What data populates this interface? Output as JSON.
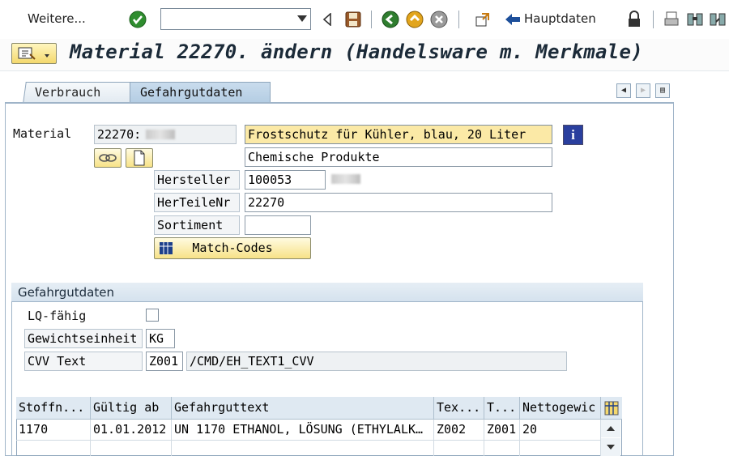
{
  "toolbar": {
    "more_label": "Weitere...",
    "command_value": "",
    "hauptdaten_label": "Hauptdaten",
    "icons": [
      "check-icon",
      "save-icon",
      "back-icon",
      "exit-icon",
      "cancel-icon",
      "other-object-icon",
      "lock-icon",
      "print-icon",
      "find-icon",
      "find-next-icon"
    ]
  },
  "title": "Material 22270.     ändern (Handelsware m. Merkmale)",
  "tabs": [
    {
      "label": "Verbrauch",
      "active": false
    },
    {
      "label": "Gefahrgutdaten",
      "active": true
    }
  ],
  "header": {
    "material_label": "Material",
    "material_value": "22270:",
    "description_value": "Frostschutz für Kühler, blau, 20 Liter",
    "category_value": "Chemische Produkte",
    "hersteller_label": "Hersteller",
    "hersteller_value": "100053",
    "herteilenr_label": "HerTeileNr",
    "herteilenr_value": "22270",
    "sortiment_label": "Sortiment",
    "sortiment_value": "",
    "matchcodes_label": "Match-Codes"
  },
  "gefahrgut": {
    "group_title": "Gefahrgutdaten",
    "lq_label": "LQ-fähig",
    "lq_checked": false,
    "gewicht_label": "Gewichtseinheit",
    "gewicht_value": "KG",
    "cvv_label": "CVV Text",
    "cvv_code": "Z001",
    "cvv_text": "/CMD/EH_TEXT1_CVV"
  },
  "table": {
    "columns": [
      "Stoffn...",
      "Gültig ab",
      "Gefahrguttext",
      "Tex...",
      "T...",
      "Nettogewic"
    ],
    "rows": [
      [
        "1170",
        "01.01.2012",
        "UN 1170 ETHANOL, LÖSUNG (ETHYLALK…",
        "Z002",
        "Z001",
        "20"
      ]
    ]
  },
  "colors": {
    "accent_yellow": "#fbe9a6",
    "tab_active": "#b4cde3",
    "header_bg": "#dfe9f2"
  }
}
